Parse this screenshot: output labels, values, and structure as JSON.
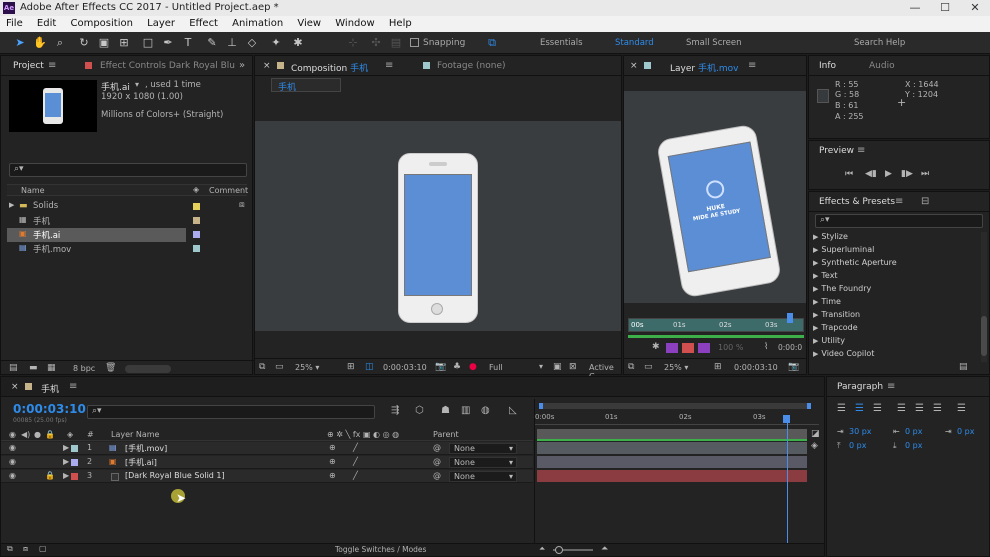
{
  "window": {
    "app_badge": "Ae",
    "title": "Adobe After Effects CC 2017 - Untitled Project.aep *",
    "min": "—",
    "max": "☐",
    "close": "✕"
  },
  "menu": [
    "File",
    "Edit",
    "Composition",
    "Layer",
    "Effect",
    "Animation",
    "View",
    "Window",
    "Help"
  ],
  "toolbar": {
    "snapping": "Snapping",
    "workspaces": [
      "Essentials",
      "Standard",
      "Small Screen"
    ],
    "search_help": "Search Help"
  },
  "project": {
    "tab": "Project",
    "effect_controls_tab": "Effect Controls Dark Royal Blu",
    "item_name": "手机.ai",
    "item_used": ", used 1 time",
    "item_size": "1920 x 1080 (1.00)",
    "item_colors": "Millions of Colors+ (Straight)",
    "col_name": "Name",
    "col_comment": "Comment",
    "items": [
      {
        "name": "Solids",
        "color": "#e6d25a"
      },
      {
        "name": "手机",
        "color": "#c7b38a"
      },
      {
        "name": "手机.ai",
        "color": "#aaaaee"
      },
      {
        "name": "手机.mov",
        "color": "#9ec8cc"
      }
    ],
    "bpc": "8 bpc"
  },
  "composition": {
    "tab_prefix": "Composition",
    "tab_name": "手机",
    "footage_tab": "Footage (none)",
    "subtab": "手机",
    "zoom": "25%",
    "timecode": "0:00:03:10",
    "resolution": "Full",
    "active": "Active C"
  },
  "layer_panel": {
    "tab_prefix": "Layer",
    "tab_name": "手机.mov",
    "phone_text_1": "HUKE",
    "phone_text_2": "MIDE AE STUDY",
    "ruler": [
      "00s",
      "01s",
      "02s",
      "03s"
    ],
    "zoom": "25%",
    "timecode": "0:00:03:10",
    "pct": "100 %",
    "end_tc": "0:00:0"
  },
  "info": {
    "tab": "Info",
    "audio_tab": "Audio",
    "r": "R : 55",
    "g": "G : 58",
    "b": "B : 61",
    "a": "A : 255",
    "x": "X : 1644",
    "y": "Y : 1204"
  },
  "preview": {
    "tab": "Preview"
  },
  "effects": {
    "tab": "Effects & Presets",
    "items": [
      "Stylize",
      "Superluminal",
      "Synthetic Aperture",
      "Text",
      "The Foundry",
      "Time",
      "Transition",
      "Trapcode",
      "Utility",
      "Video Copilot"
    ]
  },
  "paragraph": {
    "tab": "Paragraph",
    "indent_left": "30 px",
    "indent_right": "0 px",
    "indent_first": "0 px",
    "space_before": "0 px",
    "space_after": "0 px"
  },
  "timeline": {
    "tab": "手机",
    "timecode": "0:00:03:10",
    "timecode_sub": "00085 (25.00 fps)",
    "col_layer_name": "Layer Name",
    "col_parent": "Parent",
    "col_num": "#",
    "layers": [
      {
        "num": "1",
        "name": "[手机.mov]",
        "color": "#9ec8cc",
        "parent": "None",
        "bar": "#555b60"
      },
      {
        "num": "2",
        "name": "[手机.ai]",
        "color": "#aaaaee",
        "parent": "None",
        "bar": "#5a5a66"
      },
      {
        "num": "3",
        "name": "[Dark Royal Blue Solid 1]",
        "color": "#d24f4f",
        "parent": "None",
        "bar": "#8a3c40"
      }
    ],
    "ruler": [
      "0:00s",
      "01s",
      "02s",
      "03s"
    ],
    "toggle": "Toggle Switches / Modes"
  }
}
